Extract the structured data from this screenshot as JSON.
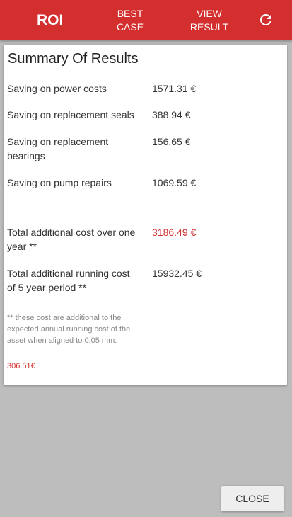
{
  "header": {
    "title": "ROI",
    "nav": [
      {
        "label": "BEST CASE"
      },
      {
        "label": "VIEW RESULT"
      }
    ],
    "refresh_icon": "refresh-icon"
  },
  "summary": {
    "title": "Summary Of Results",
    "rows": [
      {
        "label": "Saving on power costs",
        "value": "1571.31 €"
      },
      {
        "label": "Saving on replacement seals",
        "value": "388.94 €"
      },
      {
        "label": "Saving on replacement bearings",
        "value": "156.65 €"
      },
      {
        "label": "Saving on pump repairs",
        "value": "1069.59 €"
      },
      {
        "label": "Total additional cost over one year **",
        "value": "3186.49 €"
      },
      {
        "label": "Total additional running cost of 5 year period **",
        "value": "15932.45 €"
      }
    ],
    "footnote": "** these cost are additional to the expected annual running cost of the asset when aligned to 0.05 mm:",
    "footnote_value": "306.51€"
  },
  "actions": {
    "close_label": "CLOSE"
  },
  "colors": {
    "accent": "#d32f2f",
    "background": "#bdbdbd"
  }
}
